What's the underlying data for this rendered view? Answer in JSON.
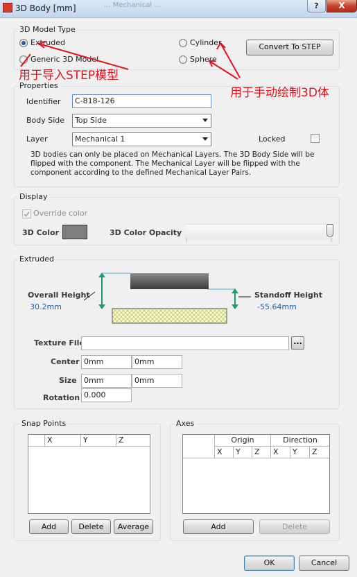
{
  "window": {
    "title": "3D Body [mm]",
    "ghost_title": "... Mechanical ...",
    "help_label": "?",
    "close_label": "X"
  },
  "model_type": {
    "group_title": "3D Model Type",
    "extruded": "Extruded",
    "generic": "Generic 3D Model",
    "cylinder": "Cylinder",
    "sphere": "Sphere",
    "selected": "Extruded",
    "convert_button": "Convert To STEP"
  },
  "annotations": {
    "left": "用于导入STEP模型",
    "right": "用于手动绘制3D体",
    "color": "#e0141b"
  },
  "properties": {
    "group_title": "Properties",
    "identifier_label": "Identifier",
    "identifier_value": "C-818-126",
    "body_side_label": "Body Side",
    "body_side_value": "Top Side",
    "layer_label": "Layer",
    "layer_value": "Mechanical 1",
    "locked_label": "Locked",
    "note": "3D bodies can only be placed on Mechanical Layers. The 3D Body Side will be flipped with the component. The Mechanical Layer will be flipped with the component according to the defined Mechanical Layer Pairs."
  },
  "display": {
    "group_title": "Display",
    "override_label": "Override color",
    "color_label": "3D Color",
    "color_value": "#7f7f7f",
    "opacity_label": "3D Color Opacity",
    "opacity_fraction": 1.0
  },
  "extruded": {
    "group_title": "Extruded",
    "overall_height_label": "Overall Height",
    "overall_height_value": "30.2mm",
    "standoff_height_label": "Standoff Height",
    "standoff_height_value": "-55.64mm",
    "texture_file_label": "Texture File",
    "texture_file_value": "",
    "browse_label": "...",
    "center_label": "Center",
    "center_x": "0mm",
    "center_y": "0mm",
    "size_label": "Size",
    "size_x": "0mm",
    "size_y": "0mm",
    "rotation_label": "Rotation",
    "rotation_value": "0.000"
  },
  "snap_points": {
    "group_title": "Snap Points",
    "columns": [
      "X",
      "Y",
      "Z"
    ],
    "add": "Add",
    "delete": "Delete",
    "average": "Average"
  },
  "axes": {
    "group_title": "Axes",
    "origin": "Origin",
    "direction": "Direction",
    "columns": [
      "X",
      "Y",
      "Z",
      "X",
      "Y",
      "Z"
    ],
    "add": "Add",
    "delete": "Delete"
  },
  "footer": {
    "ok": "OK",
    "cancel": "Cancel"
  }
}
